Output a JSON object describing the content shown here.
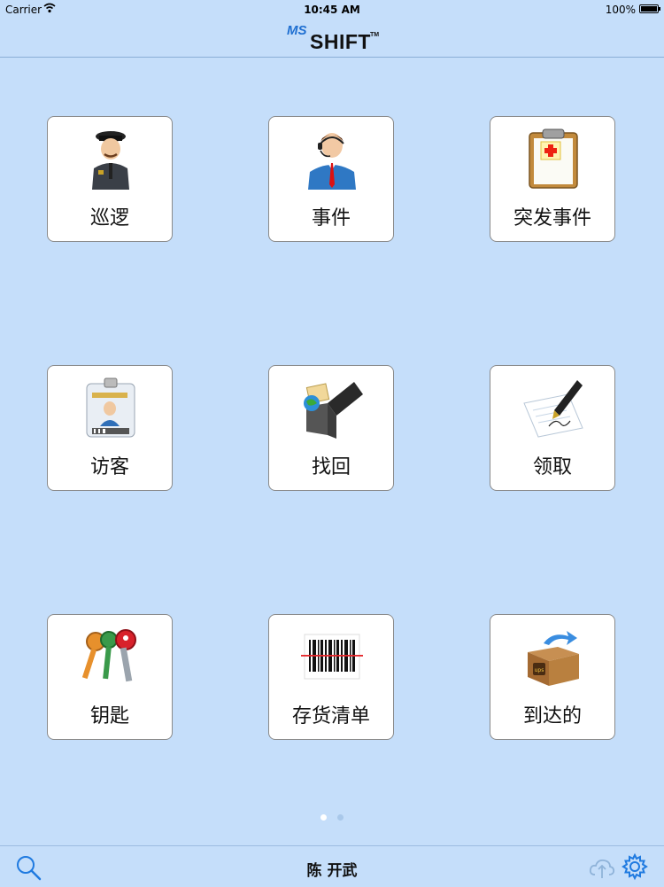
{
  "status_bar": {
    "carrier": "Carrier",
    "time": "10:45 AM",
    "battery": "100%"
  },
  "header": {
    "logo_ms": "MS",
    "logo_shift": "SHIFT",
    "logo_tm": "TM"
  },
  "tiles": [
    {
      "label": "巡逻",
      "icon": "police-officer-icon"
    },
    {
      "label": "事件",
      "icon": "operator-headset-icon"
    },
    {
      "label": "突发事件",
      "icon": "medical-clipboard-icon"
    },
    {
      "label": "访客",
      "icon": "visitor-badge-icon"
    },
    {
      "label": "找回",
      "icon": "file-archive-icon"
    },
    {
      "label": "领取",
      "icon": "pen-signing-icon"
    },
    {
      "label": "钥匙",
      "icon": "keys-icon"
    },
    {
      "label": "存货清单",
      "icon": "barcode-icon"
    },
    {
      "label": "到达的",
      "icon": "package-arrival-icon"
    }
  ],
  "pagination": {
    "current": 1,
    "total": 2
  },
  "footer": {
    "user_name": "陈 开武"
  },
  "colors": {
    "background": "#c5defa",
    "accent": "#1f6fd1"
  }
}
